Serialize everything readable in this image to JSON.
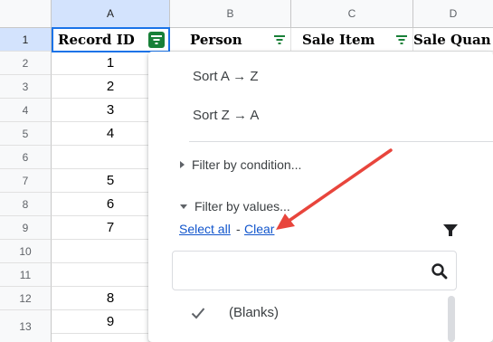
{
  "columns": [
    "A",
    "B",
    "C",
    "D"
  ],
  "rows": [
    "1",
    "2",
    "3",
    "4",
    "5",
    "6",
    "7",
    "8",
    "9",
    "10",
    "11",
    "12",
    "13"
  ],
  "headers": {
    "a": "Record ID",
    "b": "Person",
    "c": "Sale Item",
    "d": "Sale Quan"
  },
  "record_ids": [
    "1",
    "2",
    "3",
    "4",
    "",
    "5",
    "6",
    "7",
    "",
    "",
    "8",
    "9"
  ],
  "menu": {
    "sort_az": "Sort A → Z",
    "sort_za": "Sort Z → A",
    "filter_by_condition": "Filter by condition...",
    "filter_by_values": "Filter by values...",
    "select_all": "Select all",
    "separator": "-",
    "clear": "Clear",
    "search_placeholder": "",
    "values": [
      "(Blanks)"
    ]
  },
  "colors": {
    "filter_active": "#188038",
    "selection": "#1a73e8",
    "link": "#1155cc",
    "arrow": "#e8453c"
  }
}
